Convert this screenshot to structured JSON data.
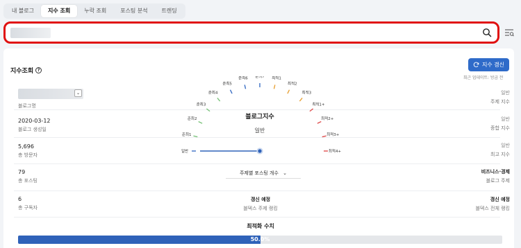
{
  "tabs": [
    "내 블로그",
    "지수 조회",
    "누락 조회",
    "포스팅 분석",
    "트렌딩"
  ],
  "active_tab": "지수 조회",
  "search": {
    "value": "",
    "placeholder": ""
  },
  "card": {
    "title": "지수조회",
    "refresh_label": "지수 갱신",
    "refresh_sub": "최근 업데이트: 방금 전"
  },
  "left": {
    "blog_name_label": "블로그명",
    "created_value": "2020-03-12",
    "created_label": "블로그 생성일",
    "visitors_value": "5,696",
    "visitors_label": "총 방문자",
    "posts_value": "79",
    "posts_label": "총 포스팅",
    "subscribers_value": "6",
    "subscribers_label": "총 구독자"
  },
  "right": {
    "topic_index_value": "일반",
    "topic_index_label": "주제 지수",
    "overall_index_value": "일반",
    "overall_index_label": "종합 지수",
    "max_index_value": "일반",
    "max_index_label": "최고 지수",
    "blog_topic_value": "비즈니스·경제",
    "blog_topic_label": "블로그 주제",
    "all_rank_value": "갱신 예정",
    "all_rank_label": "블덱스 전체 랭킹"
  },
  "gauge": {
    "title": "블로그지수",
    "current": "일반",
    "levels": [
      "일반",
      "준최1",
      "준최2",
      "준최3",
      "준최4",
      "준최5",
      "준최6",
      "준최7",
      "최적1",
      "최적2",
      "최적3",
      "최적1+",
      "최적2+",
      "최적3+",
      "최적4+"
    ],
    "level_colors": [
      "#3c6fc4",
      "#7dc47d",
      "#7dc47d",
      "#7dc47d",
      "#7dc47d",
      "#3c6fc4",
      "#3c6fc4",
      "#3c6fc4",
      "#e8a33a",
      "#e8a33a",
      "#e8a33a",
      "#e05050",
      "#e05050",
      "#e05050",
      "#e05050"
    ],
    "value_fraction": 0
  },
  "center": {
    "select_label": "주제별 포스팅 개수",
    "topic_rank_value": "갱신 예정",
    "topic_rank_label": "블덱스 주제 랭킹"
  },
  "optimization": {
    "title": "최적화 수치",
    "percent": 50.0,
    "label": "50.0%"
  },
  "colors": {
    "accent": "#2f6bc9",
    "highlight": "#e01010"
  }
}
